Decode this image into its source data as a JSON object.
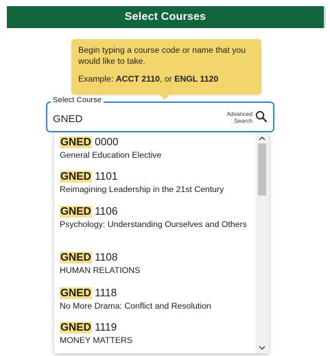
{
  "header": {
    "title": "Select Courses"
  },
  "tooltip": {
    "line1": "Begin typing a course code or name that you would like to take.",
    "example_prefix": "Example: ",
    "example_code1": "ACCT 2110",
    "example_mid": ", or ",
    "example_code2": "ENGL 1120"
  },
  "search": {
    "label": "Select Course",
    "value": "GNED",
    "advanced_line1": "Advanced",
    "advanced_line2": "Search",
    "icon": "search-icon"
  },
  "results": [
    {
      "subject": "GNED",
      "number": "0000",
      "title": "General Education Elective"
    },
    {
      "subject": "GNED",
      "number": "1101",
      "title": "Reimagining Leadership in the 21st Century"
    },
    {
      "subject": "GNED",
      "number": "1106",
      "title": "Psychology: Understanding Ourselves and Others"
    },
    {
      "subject": "GNED",
      "number": "1108",
      "title": "HUMAN RELATIONS"
    },
    {
      "subject": "GNED",
      "number": "1118",
      "title": "No More Drama: Conflict and Resolution"
    },
    {
      "subject": "GNED",
      "number": "1119",
      "title": "MONEY MATTERS"
    }
  ],
  "colors": {
    "header_bg": "#11663d",
    "tooltip_bg": "#f3d66b",
    "focus_border": "#2c8bd9",
    "highlight": "#f6df83"
  }
}
